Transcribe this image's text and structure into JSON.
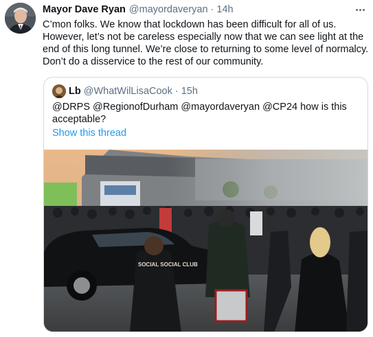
{
  "tweet": {
    "author_name": "Mayor Dave Ryan",
    "author_handle": "@mayordaveryan",
    "separator": "·",
    "time": "14h",
    "text_lines": [
      "C’mon folks.  We know that lockdown has been difficult for all of us.",
      "However, let’s not be careless especially now that we can see light at the",
      "end of this long tunnel.  We’re close to returning to some level of normalcy.",
      "Don’t do a disservice to the rest of our community."
    ],
    "more_icon": "more-horizontal-icon"
  },
  "quoted_tweet": {
    "author_name": "Lb",
    "author_handle": "@WhatWilLisaCook",
    "separator": "·",
    "time": "15h",
    "text_lines": [
      "@DRPS @RegionofDurham @mayordaveryan @CP24 how is this",
      "acceptable?"
    ],
    "show_thread": "Show this thread",
    "photo": {
      "shirt_text": "SOCIAL SOCIAL CLUB"
    }
  },
  "colors": {
    "text": "#0f1419",
    "secondary": "#5b7083",
    "link": "#1d9bf0",
    "border": "#cfd9de"
  }
}
